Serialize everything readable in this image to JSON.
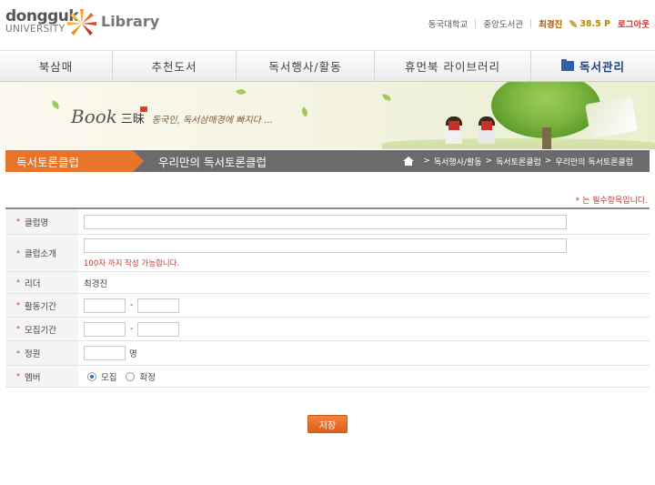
{
  "header": {
    "logo_top": "dongguk",
    "logo_bottom": "UNIVERSITY",
    "site_title": "Library",
    "links": [
      "동국대학교",
      "중앙도서관"
    ],
    "user_name": "최경진",
    "points": "38.5 P",
    "logout_label": "로그아웃"
  },
  "nav": {
    "items": [
      "북삼매",
      "추천도서",
      "독서행사/활동",
      "휴먼북 라이브러리",
      "독서관리"
    ]
  },
  "banner": {
    "book_word": "Book",
    "hanja": "三昧",
    "tagline": "동국인, 독서삼매경에 빠지다 ..."
  },
  "breadcrumb": {
    "section": "독서토론클럽",
    "page_title": "우리만의 독서토론클럽",
    "path": [
      "독서행사/활동",
      "독서토론클럽",
      "우리만의 독서토론클럽"
    ],
    "separator": ">"
  },
  "form": {
    "required_note": "* 는 필수항목입니다.",
    "required_mark": "*",
    "fields": {
      "club_name": {
        "label": "클럽명",
        "value": ""
      },
      "club_intro": {
        "label": "클럽소개",
        "value": "",
        "hint": "100자 까지 작성 가능합니다."
      },
      "leader": {
        "label": "리더",
        "value": "최경진"
      },
      "activity_period": {
        "label": "활동기간",
        "start": "",
        "end": ""
      },
      "recruit_period": {
        "label": "모집기간",
        "start": "",
        "end": ""
      },
      "capacity": {
        "label": "정원",
        "value": "",
        "unit": "명"
      },
      "members": {
        "label": "멤버",
        "options": [
          "모집",
          "확정"
        ],
        "selected": "모집"
      }
    },
    "range_dash": "-"
  },
  "actions": {
    "save_label": "저장"
  },
  "colors": {
    "accent": "#e8732a",
    "crumb_bar": "#6b6b6b",
    "required": "#c0392b",
    "nav_active": "#1b3f86"
  }
}
